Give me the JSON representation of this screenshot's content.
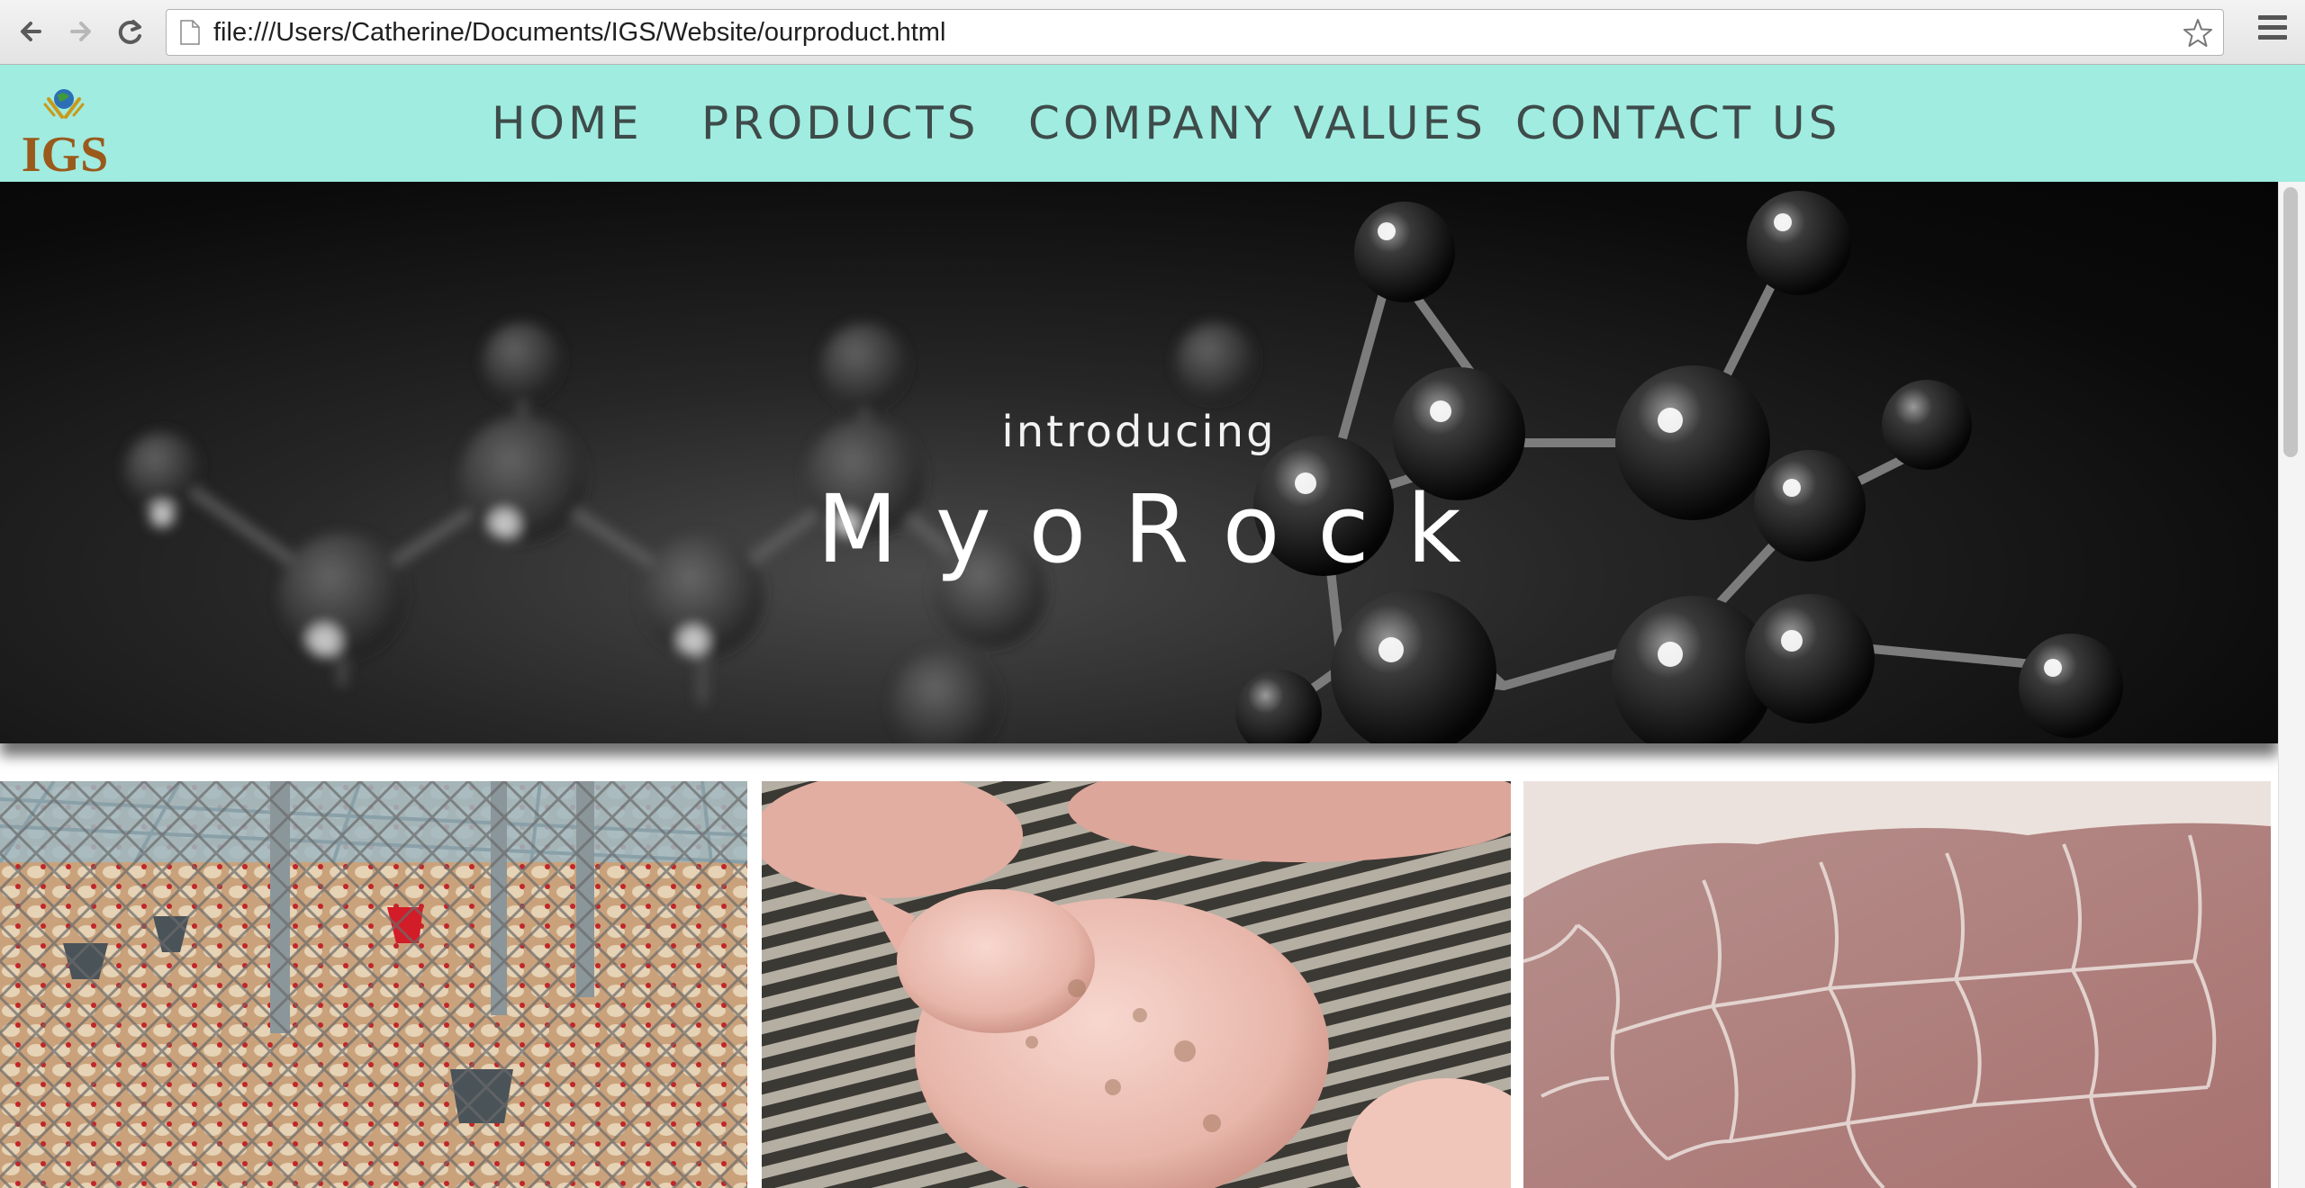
{
  "browser": {
    "url": "file:///Users/Catherine/Documents/IGS/Website/ourproduct.html",
    "icons": {
      "back": "arrow-left-icon",
      "forward": "arrow-right-icon",
      "reload": "reload-icon",
      "page": "document-icon",
      "bookmark": "star-icon",
      "menu": "hamburger-menu-icon"
    }
  },
  "header": {
    "logo_text": "IGS",
    "background": "#a0ece0",
    "nav": {
      "home": "HOME",
      "products": "PRODUCTS",
      "company_values": "COMPANY VALUES",
      "contact_us": "CONTACT US"
    }
  },
  "hero": {
    "intro": "introducing",
    "product_name": "MyoRock"
  },
  "gallery": {
    "photos": [
      "chickens-in-poultry-house-photo",
      "pig-on-slatted-floor-photo",
      "raw-meat-closeup-photo"
    ]
  }
}
